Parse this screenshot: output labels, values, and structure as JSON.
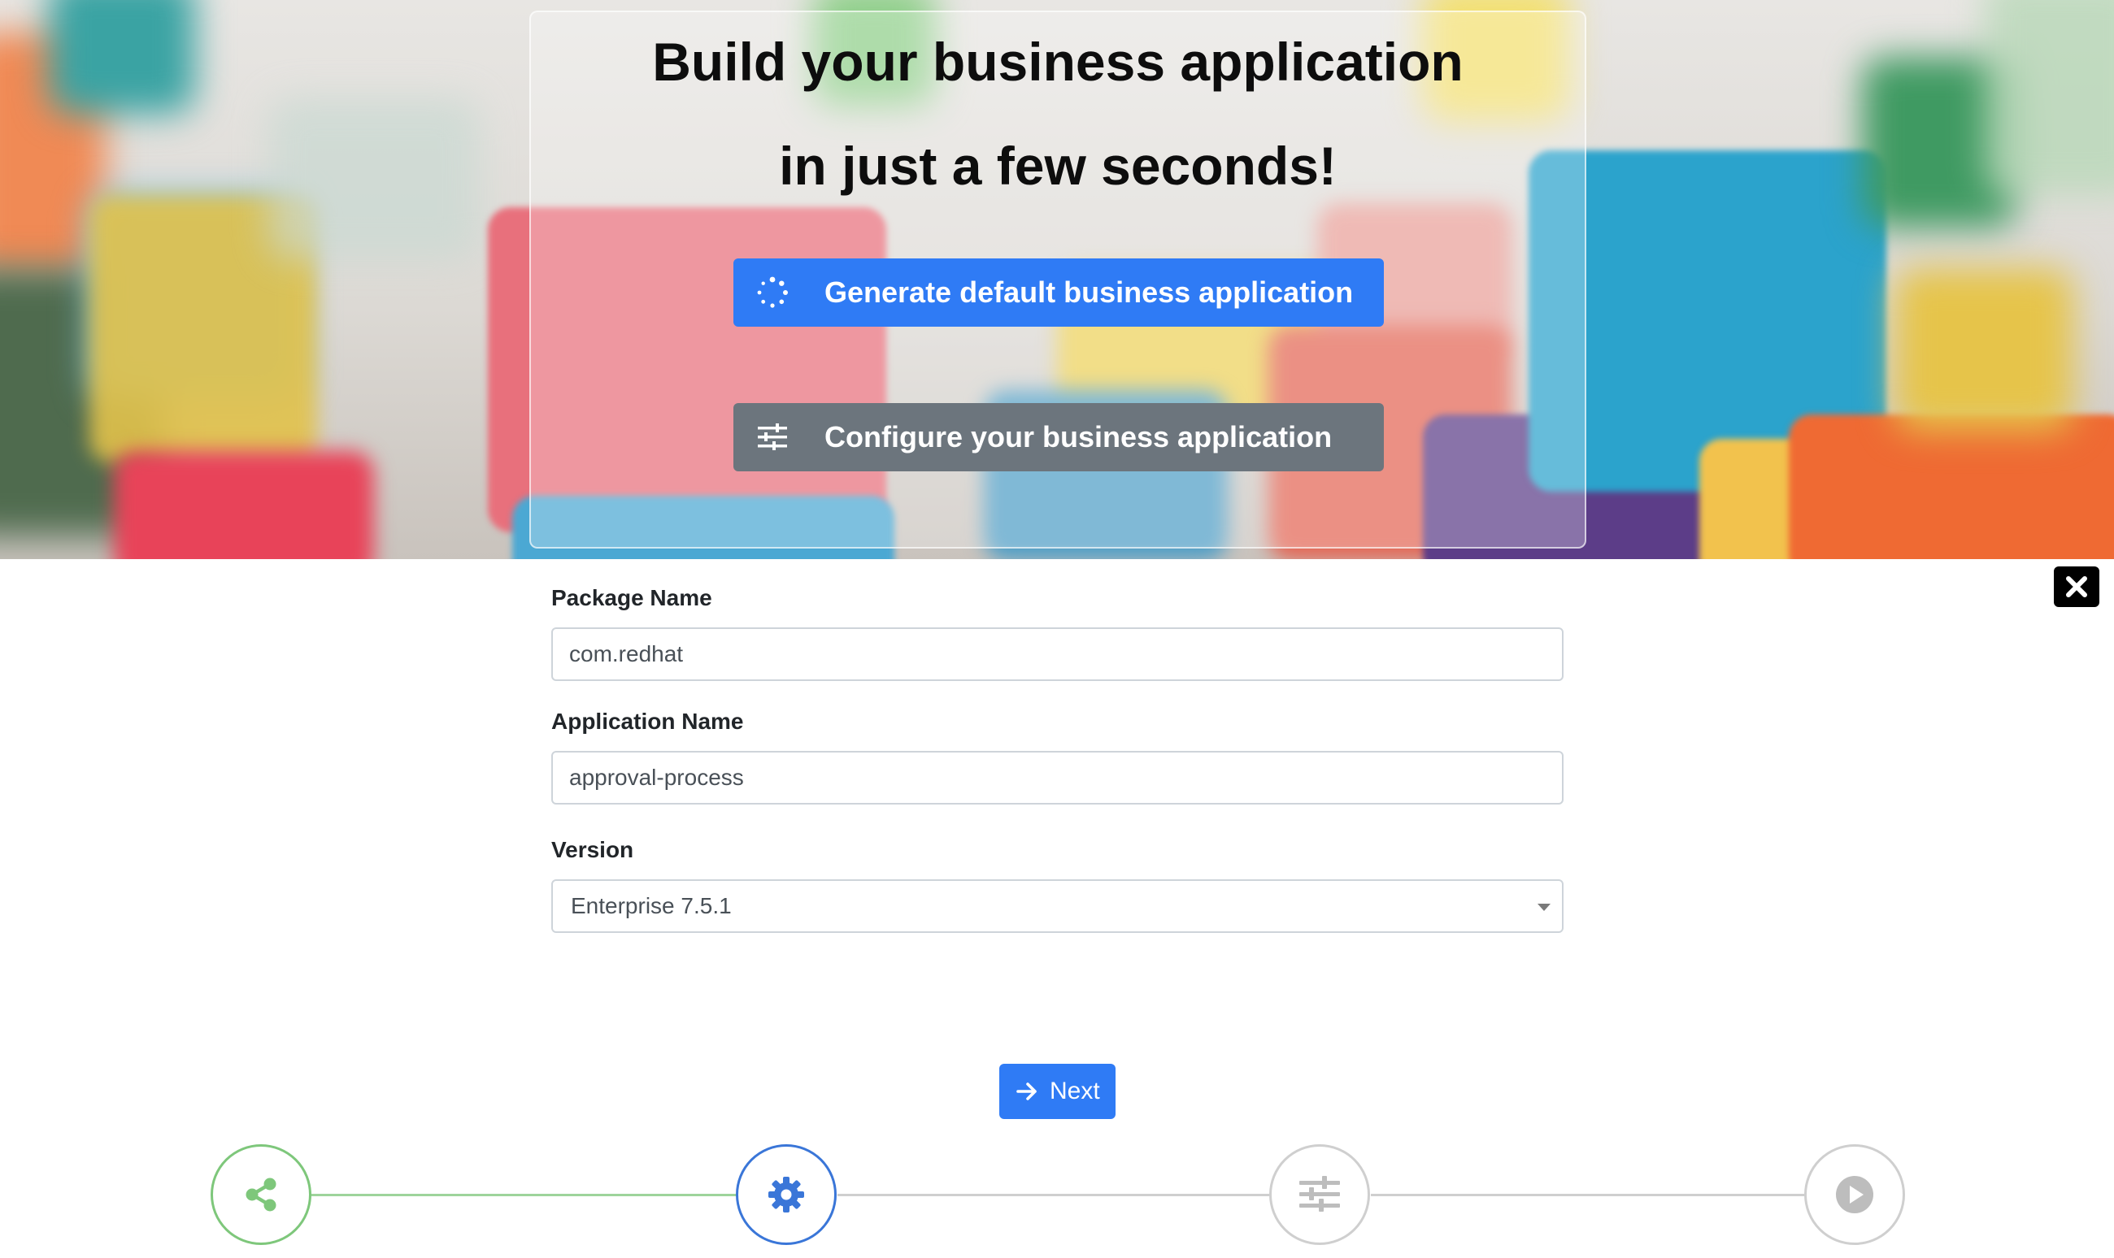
{
  "hero": {
    "title_line1": "Build your business application",
    "title_line2": "in just a few seconds!",
    "generate_button": "Generate default business application",
    "configure_button": "Configure your business application"
  },
  "form": {
    "package_name": {
      "label": "Package Name",
      "value": "com.redhat"
    },
    "application_name": {
      "label": "Application Name",
      "value": "approval-process"
    },
    "version": {
      "label": "Version",
      "selected": "Enterprise 7.5.1"
    }
  },
  "next_button": "Next",
  "stepper": {
    "steps": [
      {
        "icon": "share-icon",
        "state": "completed"
      },
      {
        "icon": "gear-icon",
        "state": "active"
      },
      {
        "icon": "sliders-icon",
        "state": "pending"
      },
      {
        "icon": "play-icon",
        "state": "pending"
      }
    ]
  },
  "colors": {
    "primary": "#2f7bf5",
    "secondary": "#6c757d",
    "completed": "#7ec77b",
    "pending": "#bdbdbd",
    "active": "#3a76d8"
  }
}
